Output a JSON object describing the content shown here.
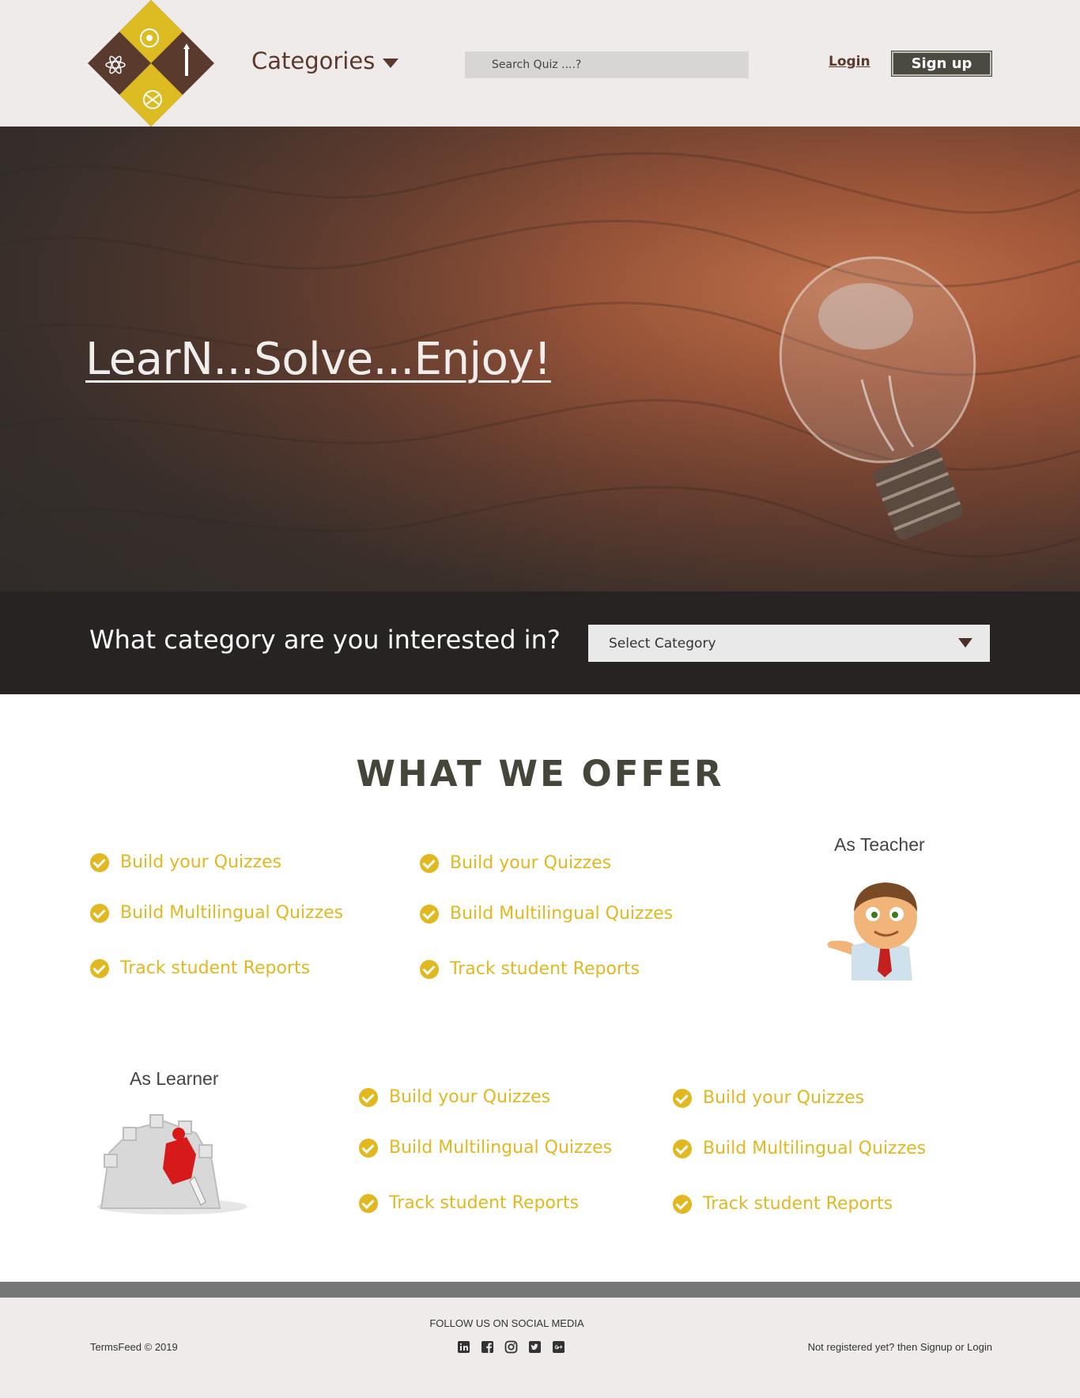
{
  "header": {
    "categories_label": "Categories",
    "search_placeholder": "Search Quiz ....?",
    "login_label": "Login",
    "signup_label": "Sign up"
  },
  "hero": {
    "title": "LearN...Solve...Enjoy!"
  },
  "category_bar": {
    "question": "What category are you interested in?",
    "select_value": "Select Category"
  },
  "offer": {
    "title": "WHAT WE OFFER",
    "teacher": {
      "label": "As Teacher",
      "col1": [
        "Build your Quizzes",
        "Build Multilingual Quizzes",
        "Track student Reports"
      ],
      "col2": [
        "Build your Quizzes",
        "Build Multilingual Quizzes",
        "Track student Reports"
      ]
    },
    "learner": {
      "label": "As Learner",
      "col1": [
        "Build your Quizzes",
        "Build Multilingual Quizzes",
        "Track student Reports"
      ],
      "col2": [
        "Build your Quizzes",
        "Build Multilingual Quizzes",
        "Track student Reports"
      ]
    }
  },
  "footer": {
    "copyright": "TermsFeed © 2019",
    "follow": "FOLLOW US ON SOCIAL MEDIA",
    "social_icons": [
      "linkedin-icon",
      "facebook-icon",
      "instagram-icon",
      "twitter-icon",
      "google-plus-icon"
    ],
    "not_registered": "Not registered yet? then Signup or Login"
  },
  "colors": {
    "brand_brown": "#5a3a2c",
    "accent_yellow": "#e1b820",
    "dark_button": "#4a4a40",
    "header_bg": "#efebea"
  }
}
